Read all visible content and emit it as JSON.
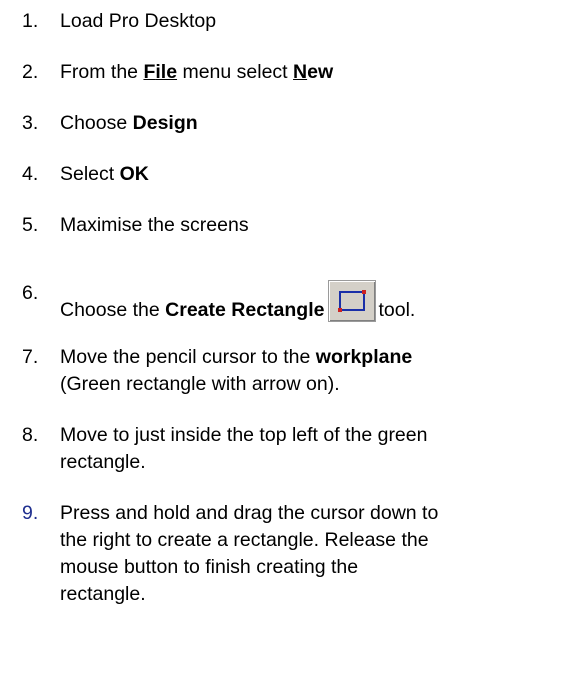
{
  "steps": [
    {
      "n": "1.",
      "t1": "Load Pro Desktop"
    },
    {
      "n": "2.",
      "t1": "From the ",
      "u1f": "F",
      "u1r": "ile",
      "t2": " menu select ",
      "u2f": "N",
      "u2r": "ew"
    },
    {
      "n": "3.",
      "t1": "Choose ",
      "b1": "Design"
    },
    {
      "n": "4.",
      "t1": "Select ",
      "b1": "OK"
    },
    {
      "n": "5.",
      "t1": "Maximise the screens"
    },
    {
      "n": "6.",
      "t1": "Choose the ",
      "b1": "Create Rectangle",
      "t2": "tool."
    },
    {
      "n": "7.",
      "t1": "Move the pencil cursor to the ",
      "b1": "workplane",
      "t2": "(Green rectangle with arrow on)."
    },
    {
      "n": "8.",
      "t1": "Move to just inside the top left of the green",
      "t2": "rectangle."
    },
    {
      "n": "9.",
      "t1": "Press and hold and drag the cursor down to",
      "t2": "the right to create a rectangle. Release the",
      "t3": "mouse button to finish creating the",
      "t4": "rectangle."
    }
  ],
  "colors": {
    "text": "#000000",
    "step9_number": "#1f2f8f",
    "icon_frame": "#d4d0c8",
    "icon_rect": "#1a2fa8",
    "icon_corner": "#cc2222"
  },
  "icons": {
    "create_rectangle_tool": "rectangle-tool-icon"
  }
}
